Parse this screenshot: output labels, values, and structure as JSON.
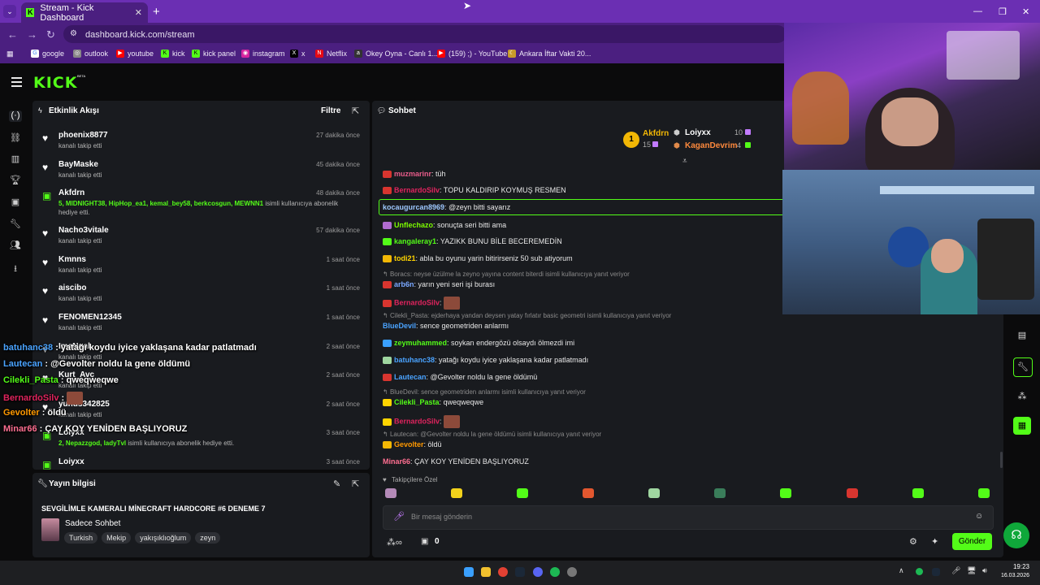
{
  "browser": {
    "tab_title": "Stream - Kick Dashboard",
    "url": "dashboard.kick.com/stream",
    "bookmarks": [
      "google",
      "outlook",
      "youtube",
      "kick",
      "kick panel",
      "instagram",
      "x",
      "Netflix",
      "Okey Oyna - Canlı 1...",
      "(159) ;) - YouTube",
      "Ankara İftar Vakti 20..."
    ]
  },
  "brand": {
    "logo": "KICK",
    "beta": "BETA",
    "accent": "#53fc18"
  },
  "activity": {
    "title": "Etkinlik Akışı",
    "filter_label": "Filtre",
    "items": [
      {
        "user": "phoenix8877",
        "desc": "kanalı takip etti",
        "time": "27 dakika önce",
        "type": "follow"
      },
      {
        "user": "BayMaske",
        "desc": "kanalı takip etti",
        "time": "45 dakika önce",
        "type": "follow"
      },
      {
        "user": "Akfdrn",
        "gift_users": "5, MIDNIGHT38, HipHop_ea1, kemal_bey58, berkcosgun, MEWNN1",
        "gift_text": "isimli kullanıcıya abonelik hediye etti.",
        "time": "48 dakika önce",
        "type": "gift"
      },
      {
        "user": "Nacho3vitale",
        "desc": "kanalı takip etti",
        "time": "57 dakika önce",
        "type": "follow"
      },
      {
        "user": "Kmnns",
        "desc": "kanalı takip etti",
        "time": "1 saat önce",
        "type": "follow"
      },
      {
        "user": "aiscibo",
        "desc": "kanalı takip etti",
        "time": "1 saat önce",
        "type": "follow"
      },
      {
        "user": "FENOMEN12345",
        "desc": "kanalı takip etti",
        "time": "1 saat önce",
        "type": "follow"
      },
      {
        "user": "ImaNgal",
        "desc": "kanalı takip etti",
        "time": "2 saat önce",
        "type": "follow"
      },
      {
        "user": "Kurt_Avc",
        "desc": "kanalı takip etti",
        "time": "2 saat önce",
        "type": "follow"
      },
      {
        "user": "yunus342825",
        "desc": "kanalı takip etti",
        "time": "2 saat önce",
        "type": "follow"
      },
      {
        "user": "Loiyxx",
        "gift_users": "2, Nepazzgod, ladyTvl",
        "gift_text": "isimli kullanıcıya abonelik hediye etti.",
        "time": "3 saat önce",
        "type": "gift"
      },
      {
        "user": "Loiyxx",
        "desc": "",
        "time": "3 saat önce",
        "type": "gift"
      }
    ]
  },
  "stream_info": {
    "title": "Yayın bilgisi",
    "stream_title": "SEVGİLİMLE KAMERALI MİNECRAFT HARDCORE #6 DENEME 7",
    "category": "Sadece Sohbet",
    "tags": [
      "Turkish",
      "Mekip",
      "yakışıklıoğlum",
      "zeyn"
    ]
  },
  "chat": {
    "title": "Sohbet",
    "leaderboard": [
      {
        "name": "Akfdrn",
        "count": "15",
        "rank": "1"
      },
      {
        "name": "Loiyxx",
        "count": "10"
      },
      {
        "name": "KaganDevrim",
        "count": "4"
      }
    ],
    "messages": [
      {
        "kind": "msg",
        "user": "muzmarinr",
        "color": "#e85c8a",
        "text": "tüh"
      },
      {
        "kind": "msg",
        "user": "BernardoSilv",
        "color": "#e0245e",
        "text": "TOPU KALDIRIP KOYMUŞ RESMEN"
      },
      {
        "kind": "msg",
        "user": "kocaugurcan8969",
        "color": "#9ec8ff",
        "text": "@zeyn bitti sayarız"
      },
      {
        "kind": "msg",
        "user": "Unflechazo",
        "color": "#7cfc00",
        "text": "sonuçta seri bitti ama"
      },
      {
        "kind": "msg",
        "user": "kangaleray1",
        "color": "#53fc18",
        "text": "YAZIKK BUNU BİLE BECEREMEDİN"
      },
      {
        "kind": "msg",
        "user": "todi21",
        "color": "#ffd400",
        "text": "abla bu oyunu yarin bitirirseniz 50 sub atiyorum"
      },
      {
        "kind": "reply",
        "text": "Boracs: neyse üzülme la zeyno yayına content biterdi isimli kullanıcıya yanıt veriyor"
      },
      {
        "kind": "msg",
        "user": "arb6n",
        "color": "#7aa8ff",
        "text": "yarın yeni seri işi burası"
      },
      {
        "kind": "msg",
        "user": "BernardoSilv",
        "color": "#e0245e",
        "text": ""
      },
      {
        "kind": "reply",
        "text": "Cilekli_Pasta: ejderhaya yandan deysen yatay fırlatır basic geometri isimli kullanıcıya yanıt veriyor"
      },
      {
        "kind": "msg",
        "user": "BlueDevil",
        "color": "#4aa3ff",
        "text": "sence geometriden anlarmı"
      },
      {
        "kind": "msg",
        "user": "zeymuhammed",
        "color": "#53fc18",
        "text": "soykan endergözü olsaydı ölmezdi imi"
      },
      {
        "kind": "msg",
        "user": "batuhanc38",
        "color": "#4aa3ff",
        "text": "yatağı koydu iyice yaklaşana kadar patlatmadı"
      },
      {
        "kind": "msg",
        "user": "Lautecan",
        "color": "#4aa3ff",
        "text": "@Gevolter noldu la gene öldümü"
      },
      {
        "kind": "reply",
        "text": "BlueDevil: sence geometriden anlarmı isimli kullanıcıya yanıt veriyor"
      },
      {
        "kind": "msg",
        "user": "Cilekli_Pasta",
        "color": "#53fc18",
        "text": "qweqweqwe"
      },
      {
        "kind": "msg",
        "user": "BernardoSilv",
        "color": "#e0245e",
        "text": ""
      },
      {
        "kind": "reply",
        "text": "Lautecan: @Gevolter noldu la gene öldümü isimli kullanıcıya yanıt veriyor"
      },
      {
        "kind": "msg",
        "user": "Gevolter",
        "color": "#ff9900",
        "text": "öldü"
      },
      {
        "kind": "msg",
        "user": "Minar66",
        "color": "#ff6f91",
        "text": "ÇAY KOY YENİDEN BAŞLIYORUZ"
      }
    ],
    "followers_only": "Takipçilere Özel",
    "input_placeholder": "Bir mesaj gönderin",
    "points": "0",
    "send_label": "Gönder"
  },
  "overlay_chat": [
    {
      "user": "batuhanc38",
      "color": "#4aa3ff",
      "text": "yatağı koydu iyice yaklaşana kadar patlatmadı"
    },
    {
      "user": "Lautecan",
      "color": "#4aa3ff",
      "text": "@Gevolter noldu la gene öldümü"
    },
    {
      "user": "Cilekli_Pasta",
      "color": "#53fc18",
      "text": "qweqweqwe"
    },
    {
      "user": "BernardoSilv",
      "color": "#e0245e",
      "text": ""
    },
    {
      "user": "Gevolter",
      "color": "#ff9900",
      "text": "öldü"
    },
    {
      "user": "Minar66",
      "color": "#ff6f91",
      "text": "ÇAY KOY YENİDEN BAŞLIYORUZ"
    }
  ],
  "taskbar": {
    "time": "19:23",
    "date": "16.03.2026"
  }
}
